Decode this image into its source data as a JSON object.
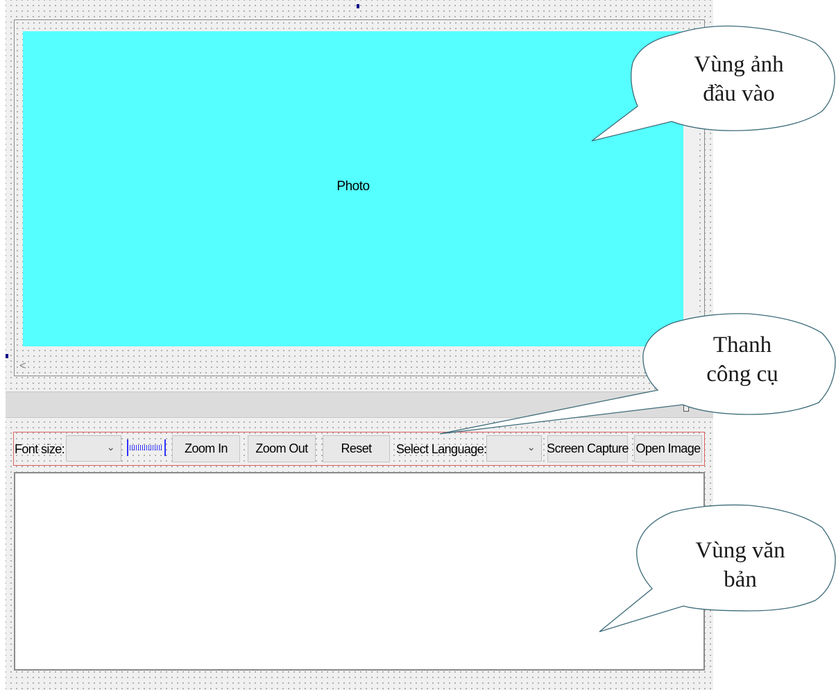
{
  "photo_area": {
    "label": "Photo",
    "background_color": "#55ffff",
    "hscroll_arrow": "<"
  },
  "toolbar": {
    "font_size_label": "Font size:",
    "font_size_value": "",
    "zoom_in_label": "Zoom In",
    "zoom_out_label": "Zoom Out",
    "reset_label": "Reset",
    "select_language_label": "Select Language:",
    "language_value": "",
    "screen_capture_label": "Screen Capture",
    "open_image_label": "Open Image",
    "dropdown_icon": "chevron-down-icon",
    "border_color": "#e06060"
  },
  "callouts": {
    "input_image": {
      "line1": "Vùng ảnh",
      "line2": "đầu vào"
    },
    "toolbar": {
      "line1": "Thanh",
      "line2": "công cụ"
    },
    "text_area": {
      "line1": "Vùng văn",
      "line2": "bản"
    }
  },
  "text_area": {
    "content": ""
  }
}
